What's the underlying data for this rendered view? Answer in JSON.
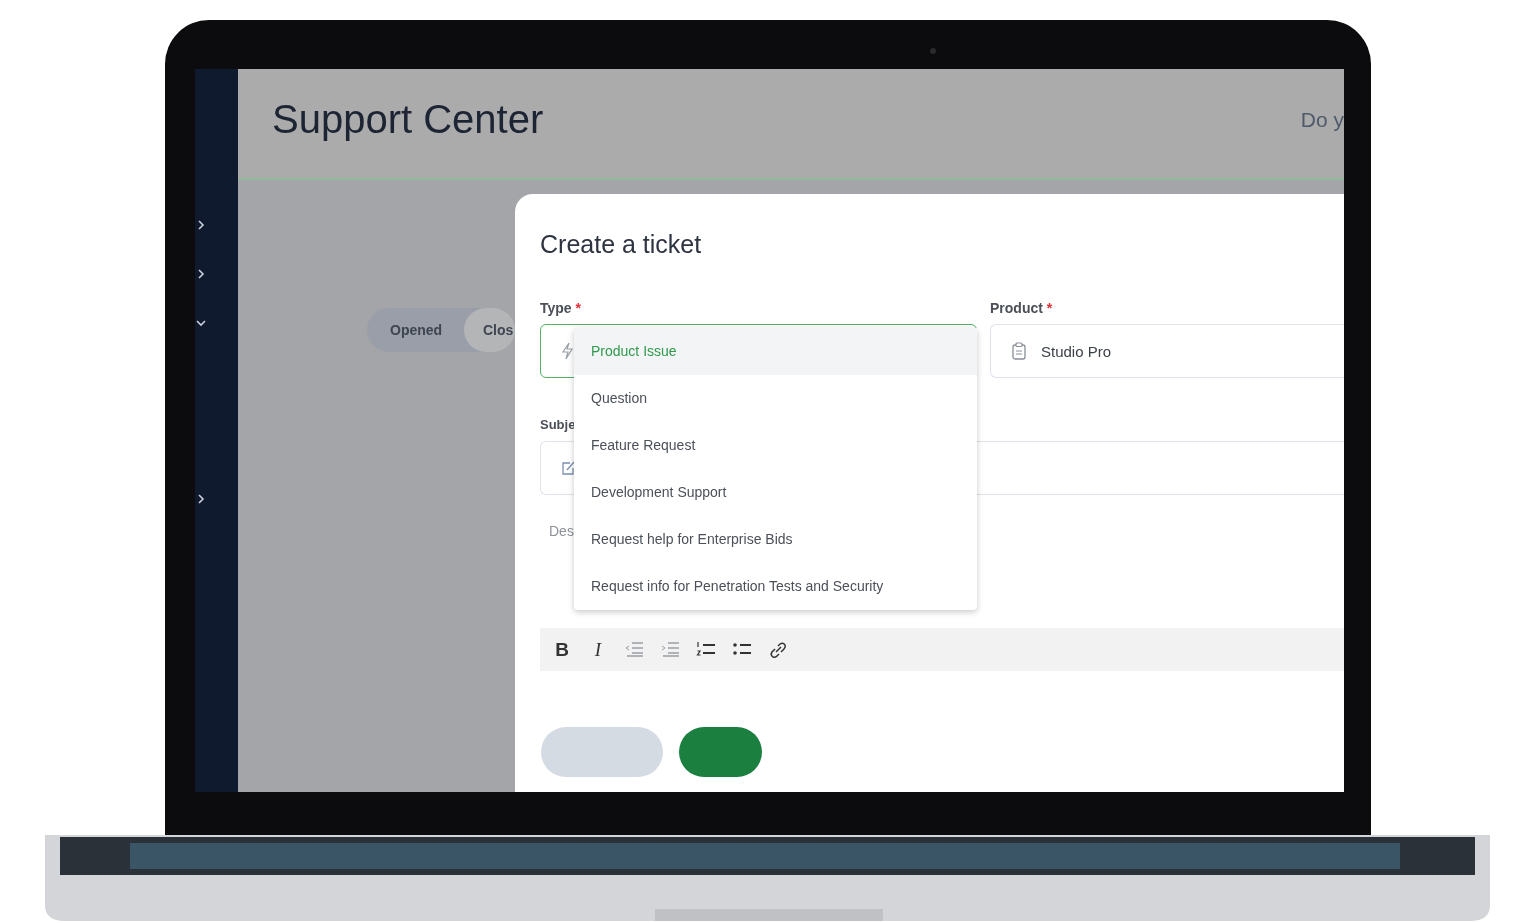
{
  "sidebar": {
    "items": [
      {
        "expanded": false
      },
      {
        "expanded": false
      },
      {
        "expanded": true
      },
      {
        "expanded": false
      }
    ]
  },
  "header": {
    "title": "Support Center",
    "text": "Do y"
  },
  "status_tabs": [
    {
      "label": "Opened",
      "selected": false
    },
    {
      "label": "Clos",
      "selected": true
    }
  ],
  "modal": {
    "title": "Create a ticket",
    "type_field": {
      "label": "Type",
      "required_mark": "*",
      "focused": true
    },
    "product_field": {
      "label": "Product",
      "required_mark": "*",
      "value": "Studio Pro",
      "focused": false
    },
    "subject_field": {
      "label": "Subje"
    },
    "description": {
      "placeholder": "Des"
    },
    "toolbar": [
      {
        "kind": "bold",
        "label": "B"
      },
      {
        "kind": "italic",
        "label": "I"
      },
      {
        "kind": "outdent"
      },
      {
        "kind": "indent"
      },
      {
        "kind": "ordered-list"
      },
      {
        "kind": "bullet-list"
      },
      {
        "kind": "link"
      }
    ],
    "actions": [
      {
        "kind": "secondary"
      },
      {
        "kind": "primary"
      }
    ]
  },
  "type_dropdown": {
    "options": [
      {
        "label": "Product Issue",
        "selected": true
      },
      {
        "label": "Question",
        "selected": false
      },
      {
        "label": "Feature Request",
        "selected": false
      },
      {
        "label": "Development Support",
        "selected": false
      },
      {
        "label": "Request help for Enterprise Bids",
        "selected": false
      },
      {
        "label": "Request info for Penetration Tests and Security",
        "selected": false
      }
    ]
  }
}
